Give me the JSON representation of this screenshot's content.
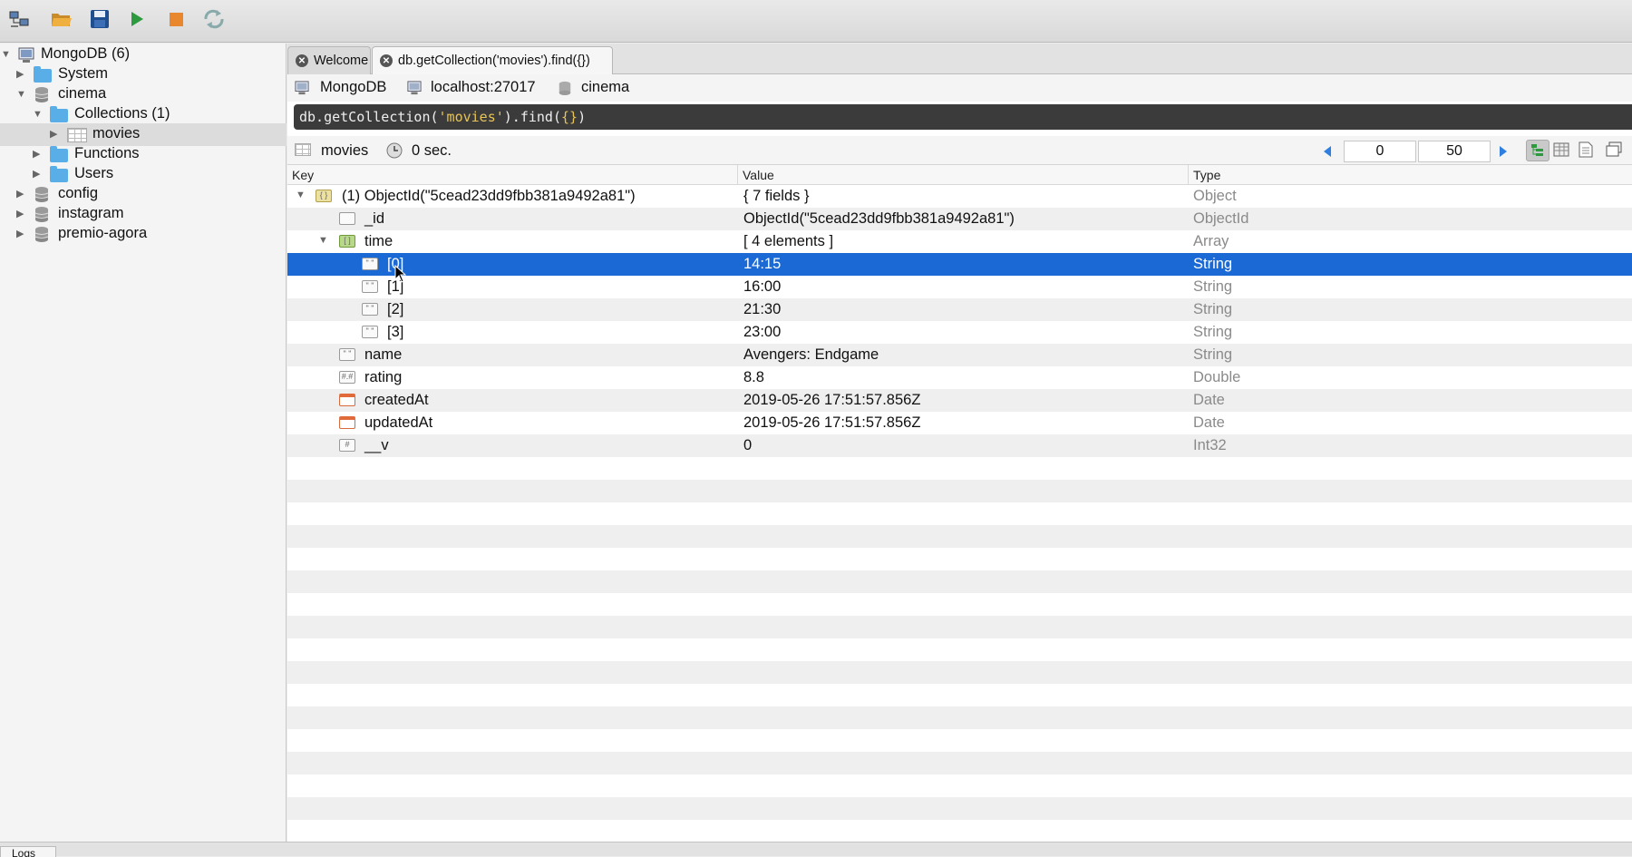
{
  "toolbar": {
    "buttons": [
      "connect-icon",
      "open-icon",
      "save-icon",
      "run-icon",
      "stop-icon",
      "refresh-icon"
    ],
    "accent_run": "#2e9a3f",
    "accent_stop": "#e9872f"
  },
  "sidebar": {
    "root_label": "MongoDB (6)",
    "items": [
      {
        "label": "System"
      },
      {
        "label": "cinema"
      },
      {
        "label": "Collections (1)"
      },
      {
        "label": "movies"
      },
      {
        "label": "Functions"
      },
      {
        "label": "Users"
      },
      {
        "label": "config"
      },
      {
        "label": "instagram"
      },
      {
        "label": "premio-agora"
      }
    ]
  },
  "tabs": [
    {
      "label": "Welcome"
    },
    {
      "label": "db.getCollection('movies').find({})"
    }
  ],
  "connection": {
    "server": "MongoDB",
    "host": "localhost:27017",
    "database": "cinema"
  },
  "query": {
    "prefix": "db.getCollection(",
    "arg": "'movies'",
    "mid": ").find(",
    "obj": "{}",
    "suffix": ")"
  },
  "results": {
    "collection": "movies",
    "time": "0 sec.",
    "skip": "0",
    "limit": "50"
  },
  "grid": {
    "headers": {
      "key": "Key",
      "value": "Value",
      "type": "Type"
    },
    "rows": [
      {
        "key": "(1) ObjectId(\"5cead23dd9fbb381a9492a81\")",
        "value": "{ 7 fields }",
        "type": "Object",
        "icon": "object-icon"
      },
      {
        "key": "_id",
        "value": "ObjectId(\"5cead23dd9fbb381a9492a81\")",
        "type": "ObjectId",
        "icon": "objectid-icon"
      },
      {
        "key": "time",
        "value": "[ 4 elements ]",
        "type": "Array",
        "icon": "array-icon"
      },
      {
        "key": "[0]",
        "value": "14:15",
        "type": "String",
        "icon": "string-icon"
      },
      {
        "key": "[1]",
        "value": "16:00",
        "type": "String",
        "icon": "string-icon"
      },
      {
        "key": "[2]",
        "value": "21:30",
        "type": "String",
        "icon": "string-icon"
      },
      {
        "key": "[3]",
        "value": "23:00",
        "type": "String",
        "icon": "string-icon"
      },
      {
        "key": "name",
        "value": "Avengers: Endgame",
        "type": "String",
        "icon": "string-icon"
      },
      {
        "key": "rating",
        "value": "8.8",
        "type": "Double",
        "icon": "double-icon"
      },
      {
        "key": "createdAt",
        "value": "2019-05-26 17:51:57.856Z",
        "type": "Date",
        "icon": "date-icon"
      },
      {
        "key": "updatedAt",
        "value": "2019-05-26 17:51:57.856Z",
        "type": "Date",
        "icon": "date-icon"
      },
      {
        "key": "__v",
        "value": "0",
        "type": "Int32",
        "icon": "int-icon"
      }
    ]
  },
  "statusbar": {
    "logs_label": "Logs"
  }
}
